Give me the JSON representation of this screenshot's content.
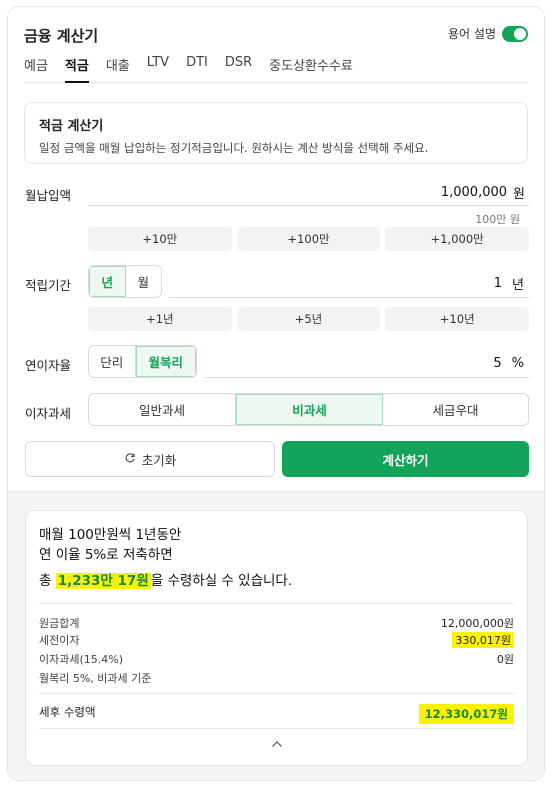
{
  "header": {
    "title": "금융 계산기",
    "help_label": "용어 설명"
  },
  "tabs": [
    "예금",
    "적금",
    "대출",
    "LTV",
    "DTI",
    "DSR",
    "중도상환수수료"
  ],
  "active_tab": "적금",
  "info": {
    "title": "적금 계산기",
    "desc": "일정 금액을 매월 납입하는 정기적금입니다. 원하시는 계산 방식을 선택해 주세요."
  },
  "monthly": {
    "label": "월납입액",
    "value": "1,000,000",
    "unit": "원",
    "hint": "100만 원",
    "chips": [
      "+10만",
      "+100만",
      "+1,000만"
    ]
  },
  "period": {
    "label": "적립기간",
    "options": [
      "년",
      "월"
    ],
    "selected": "년",
    "value": "1",
    "unit": "년",
    "chips": [
      "+1년",
      "+5년",
      "+10년"
    ]
  },
  "rate": {
    "label": "연이자율",
    "options": [
      "단리",
      "월복리"
    ],
    "selected": "월복리",
    "value": "5",
    "unit": "%"
  },
  "tax": {
    "label": "이자과세",
    "options": [
      "일반과세",
      "비과세",
      "세금우대"
    ],
    "selected": "비과세"
  },
  "buttons": {
    "reset": "초기화",
    "calculate": "계산하기"
  },
  "result": {
    "line1": "매월 100만원씩 1년동안",
    "line2": "연 이율 5%로 저축하면",
    "total_prefix": "총 ",
    "total_amount": "1,233만 17원",
    "total_suffix": "을 수령하실 수 있습니다.",
    "principal_label": "원금합계",
    "principal_value": "12,000,000원",
    "pretax_label": "세전이자",
    "pretax_value": "330,017원",
    "taxrate_label": "이자과세(15.4%)",
    "taxrate_value": "0원",
    "basis": "월복리 5%, 비과세 기준",
    "net_label": "세후 수령액",
    "net_value": "12,330,017원"
  },
  "colors": {
    "accent": "#12a55a",
    "highlight": "#fff200"
  },
  "icons": {
    "reset": "refresh-icon",
    "collapse": "chevron-up-icon"
  }
}
